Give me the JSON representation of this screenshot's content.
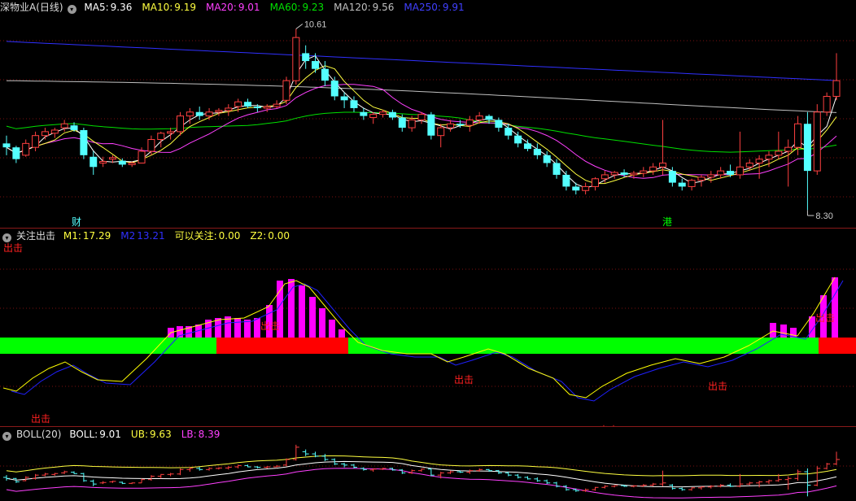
{
  "colors": {
    "up": "#ff4040",
    "down": "#54ffff",
    "ma5": "#ffffff",
    "ma10": "#ffff40",
    "ma20": "#ff40ff",
    "ma60": "#00e000",
    "ma120": "#c0c0c0",
    "ma250": "#3030ff",
    "grid": "#7a1010"
  },
  "main_panel": {
    "title": "深物业A(日线)",
    "indicators": [
      {
        "label": "MA5:",
        "value": "9.36",
        "color": "#ffffff"
      },
      {
        "label": "MA10:",
        "value": "9.19",
        "color": "#ffff40"
      },
      {
        "label": "MA20:",
        "value": "9.01",
        "color": "#ff40ff"
      },
      {
        "label": "MA60:",
        "value": "9.23",
        "color": "#00e000"
      },
      {
        "label": "MA120:",
        "value": "9.56",
        "color": "#c0c0c0"
      },
      {
        "label": "MA250:",
        "value": "9.91",
        "color": "#4040ff"
      }
    ],
    "high_label": "10.61",
    "low_label": "8.30",
    "markers": [
      {
        "text": "财",
        "color": "#54ffff"
      },
      {
        "text": "港",
        "color": "#00ff00"
      }
    ]
  },
  "indicator_panel": {
    "title": "关注出击",
    "indicators": [
      {
        "label": "M1:",
        "value": "17.29",
        "color": "#ffff40"
      },
      {
        "label": "M2",
        "value": "13.21",
        "color": "#3030ff"
      },
      {
        "label": "可以关注:",
        "value": "0.00",
        "color": "#ffff40"
      },
      {
        "label": "Z2:",
        "value": "0.00",
        "color": "#ffff40"
      }
    ],
    "signal_text": "出击"
  },
  "boll_panel": {
    "title": "BOLL(20)",
    "indicators": [
      {
        "label": "BOLL:",
        "value": "9.01",
        "color": "#ffffff"
      },
      {
        "label": "UB:",
        "value": "9.63",
        "color": "#ffff40"
      },
      {
        "label": "LB:",
        "value": "8.39",
        "color": "#ff40ff"
      }
    ]
  },
  "chart_data": {
    "type": "candlestick",
    "price_range": [
      8.2,
      10.75
    ],
    "candles": [
      [
        9.15,
        9.25,
        9.0,
        9.1
      ],
      [
        9.1,
        9.12,
        8.9,
        8.95
      ],
      [
        9.0,
        9.2,
        8.98,
        9.15
      ],
      [
        9.1,
        9.3,
        9.05,
        9.25
      ],
      [
        9.25,
        9.35,
        9.2,
        9.3
      ],
      [
        9.28,
        9.35,
        9.22,
        9.32
      ],
      [
        9.35,
        9.45,
        9.3,
        9.4
      ],
      [
        9.38,
        9.42,
        9.3,
        9.32
      ],
      [
        9.32,
        9.35,
        8.95,
        9.0
      ],
      [
        8.98,
        9.05,
        8.75,
        8.85
      ],
      [
        8.9,
        8.98,
        8.85,
        8.92
      ],
      [
        8.95,
        9.0,
        8.9,
        8.97
      ],
      [
        8.93,
        8.96,
        8.85,
        8.88
      ],
      [
        8.88,
        8.92,
        8.85,
        8.9
      ],
      [
        8.9,
        9.1,
        8.9,
        9.05
      ],
      [
        9.05,
        9.25,
        9.0,
        9.2
      ],
      [
        9.2,
        9.3,
        9.1,
        9.28
      ],
      [
        9.28,
        9.35,
        9.2,
        9.3
      ],
      [
        9.3,
        9.55,
        9.25,
        9.5
      ],
      [
        9.5,
        9.6,
        9.4,
        9.55
      ],
      [
        9.55,
        9.62,
        9.45,
        9.5
      ],
      [
        9.5,
        9.6,
        9.45,
        9.55
      ],
      [
        9.55,
        9.6,
        9.5,
        9.57
      ],
      [
        9.57,
        9.65,
        9.5,
        9.6
      ],
      [
        9.62,
        9.72,
        9.55,
        9.68
      ],
      [
        9.68,
        9.72,
        9.6,
        9.62
      ],
      [
        9.62,
        9.65,
        9.55,
        9.6
      ],
      [
        9.6,
        9.65,
        9.55,
        9.62
      ],
      [
        9.62,
        9.7,
        9.6,
        9.65
      ],
      [
        9.7,
        10.0,
        9.65,
        9.95
      ],
      [
        9.95,
        10.61,
        9.9,
        10.5
      ],
      [
        10.3,
        10.4,
        10.1,
        10.2
      ],
      [
        10.2,
        10.3,
        10.05,
        10.1
      ],
      [
        10.1,
        10.2,
        9.88,
        9.95
      ],
      [
        9.95,
        10.0,
        9.7,
        9.75
      ],
      [
        9.75,
        9.8,
        9.6,
        9.7
      ],
      [
        9.7,
        9.75,
        9.55,
        9.6
      ],
      [
        9.55,
        9.6,
        9.45,
        9.5
      ],
      [
        9.48,
        9.55,
        9.4,
        9.52
      ],
      [
        9.52,
        9.58,
        9.48,
        9.55
      ],
      [
        9.55,
        9.58,
        9.45,
        9.48
      ],
      [
        9.48,
        9.52,
        9.3,
        9.35
      ],
      [
        9.35,
        9.5,
        9.3,
        9.45
      ],
      [
        9.45,
        9.55,
        9.4,
        9.52
      ],
      [
        9.52,
        9.55,
        9.2,
        9.25
      ],
      [
        9.25,
        9.4,
        9.1,
        9.35
      ],
      [
        9.35,
        9.45,
        9.3,
        9.4
      ],
      [
        9.4,
        9.45,
        9.35,
        9.38
      ],
      [
        9.38,
        9.5,
        9.3,
        9.45
      ],
      [
        9.45,
        9.55,
        9.4,
        9.5
      ],
      [
        9.5,
        9.52,
        9.4,
        9.45
      ],
      [
        9.45,
        9.48,
        9.3,
        9.35
      ],
      [
        9.35,
        9.4,
        9.2,
        9.25
      ],
      [
        9.25,
        9.3,
        9.1,
        9.15
      ],
      [
        9.15,
        9.2,
        9.05,
        9.08
      ],
      [
        9.08,
        9.15,
        8.95,
        9.0
      ],
      [
        9.0,
        9.05,
        8.85,
        8.9
      ],
      [
        8.9,
        8.95,
        8.7,
        8.75
      ],
      [
        8.75,
        8.8,
        8.55,
        8.6
      ],
      [
        8.6,
        8.65,
        8.5,
        8.55
      ],
      [
        8.55,
        8.65,
        8.5,
        8.6
      ],
      [
        8.6,
        8.72,
        8.55,
        8.7
      ],
      [
        8.7,
        8.8,
        8.65,
        8.75
      ],
      [
        8.75,
        8.8,
        8.7,
        8.78
      ],
      [
        8.78,
        8.82,
        8.72,
        8.75
      ],
      [
        8.75,
        8.8,
        8.7,
        8.77
      ],
      [
        8.77,
        8.85,
        8.72,
        8.8
      ],
      [
        8.8,
        8.9,
        8.75,
        8.85
      ],
      [
        8.85,
        9.45,
        8.75,
        8.9
      ],
      [
        8.8,
        8.85,
        8.6,
        8.65
      ],
      [
        8.65,
        8.7,
        8.55,
        8.6
      ],
      [
        8.6,
        8.7,
        8.55,
        8.68
      ],
      [
        8.68,
        8.75,
        8.6,
        8.72
      ],
      [
        8.72,
        8.8,
        8.65,
        8.75
      ],
      [
        8.75,
        8.85,
        8.7,
        8.8
      ],
      [
        8.8,
        8.88,
        8.72,
        8.75
      ],
      [
        8.75,
        9.3,
        8.7,
        8.85
      ],
      [
        8.85,
        8.95,
        8.8,
        8.9
      ],
      [
        8.9,
        9.0,
        8.7,
        8.95
      ],
      [
        8.95,
        9.05,
        8.85,
        9.0
      ],
      [
        9.0,
        9.3,
        8.95,
        9.05
      ],
      [
        9.05,
        9.2,
        8.6,
        9.1
      ],
      [
        9.1,
        9.5,
        9.0,
        9.4
      ],
      [
        9.4,
        9.55,
        8.3,
        8.8
      ],
      [
        8.8,
        9.65,
        8.75,
        9.55
      ],
      [
        9.55,
        9.8,
        9.5,
        9.75
      ],
      [
        9.75,
        10.3,
        9.7,
        9.95
      ]
    ]
  }
}
